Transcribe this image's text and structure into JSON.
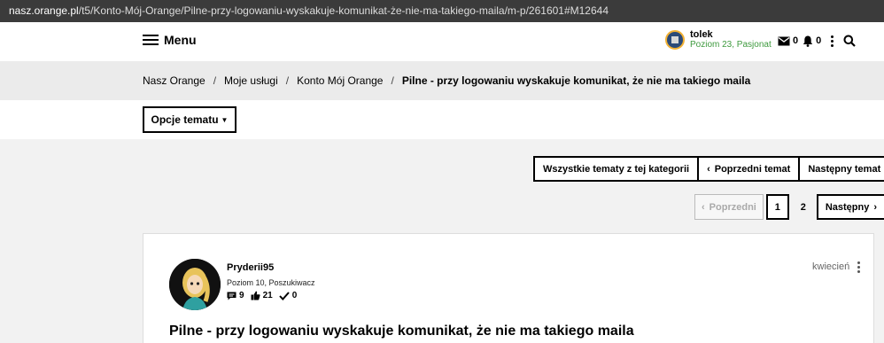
{
  "browser": {
    "url_host": "nasz.orange.pl",
    "url_path": "/t5/Konto-Mój-Orange/Pilne-przy-logowaniu-wyskakuje-komunikat-że-nie-ma-takiego-maila/m-p/261601#M12644"
  },
  "header": {
    "menu_label": "Menu",
    "user_name": "tolek",
    "user_rank": "Poziom 23, Pasjonat",
    "messages_count": "0",
    "notifications_count": "0"
  },
  "breadcrumb": {
    "items": [
      "Nasz Orange",
      "Moje usługi",
      "Konto Mój Orange"
    ],
    "separator": "/",
    "current": "Pilne - przy logowaniu wyskakuje komunikat, że nie ma takiego maila"
  },
  "topic_options": {
    "label": "Opcje tematu"
  },
  "topic_nav": {
    "all_topics": "Wszystkie tematy z tej kategorii",
    "previous": "Poprzedni temat",
    "next": "Następny temat"
  },
  "pagination": {
    "previous": "Poprzedni",
    "pages": [
      "1",
      "2"
    ],
    "current_page": "1",
    "next": "Następny"
  },
  "post": {
    "author": "Pryderii95",
    "author_rank": "Poziom 10, Poszukiwacz",
    "posts_count": "9",
    "kudos_count": "21",
    "solutions_count": "0",
    "date": "kwiecień",
    "title": "Pilne - przy logowaniu wyskakuje komunikat, że nie ma takiego maila"
  },
  "colors": {
    "rank_green": "#3e9a3e",
    "url_bar": "#3b3b3b",
    "breadcrumb_bg": "#ebebeb"
  }
}
